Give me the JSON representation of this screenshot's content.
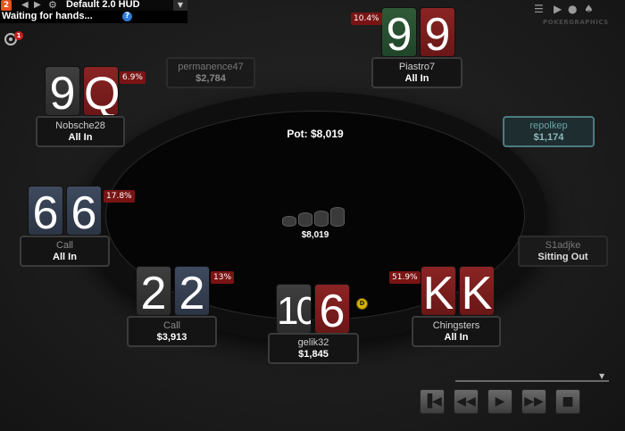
{
  "hud": {
    "badge": "2",
    "hud_name": "Default 2.0 HUD",
    "status": "Waiting for hands...",
    "help": "?"
  },
  "notifications": {
    "count": "1"
  },
  "brand": "POKERGRAPHICS",
  "table": {
    "pot_label": "Pot: $8,019",
    "center_amount": "$8,019",
    "dealer_button": "D"
  },
  "seats": [
    {
      "name": "Piastro7",
      "stack": "All In",
      "equity": "10.4%",
      "cards": [
        "9",
        "9"
      ]
    },
    {
      "name": "permanence47",
      "stack": "$2,784"
    },
    {
      "name": "Nobsche28",
      "stack": "All In",
      "equity": "6.9%",
      "cards": [
        "9",
        "Q"
      ]
    },
    {
      "name": "repolkep",
      "stack": "$1,174"
    },
    {
      "name": "Call",
      "stack": "All In",
      "equity": "17.8%",
      "cards": [
        "6",
        "6"
      ]
    },
    {
      "name": "S1adjke",
      "stack": "Sitting Out"
    },
    {
      "name": "Call",
      "stack": "$3,913",
      "equity": "13%",
      "cards": [
        "2",
        "2"
      ]
    },
    {
      "name": "gelik32",
      "stack": "$1,845",
      "cards": [
        "10",
        "6"
      ]
    },
    {
      "name": "Chingsters",
      "stack": "All In",
      "equity": "51.9%",
      "cards": [
        "K",
        "K"
      ]
    }
  ],
  "replayer": {
    "progress": 1.0,
    "buttons": [
      "step-back",
      "rewind",
      "play",
      "fast-forward",
      "stop"
    ]
  }
}
